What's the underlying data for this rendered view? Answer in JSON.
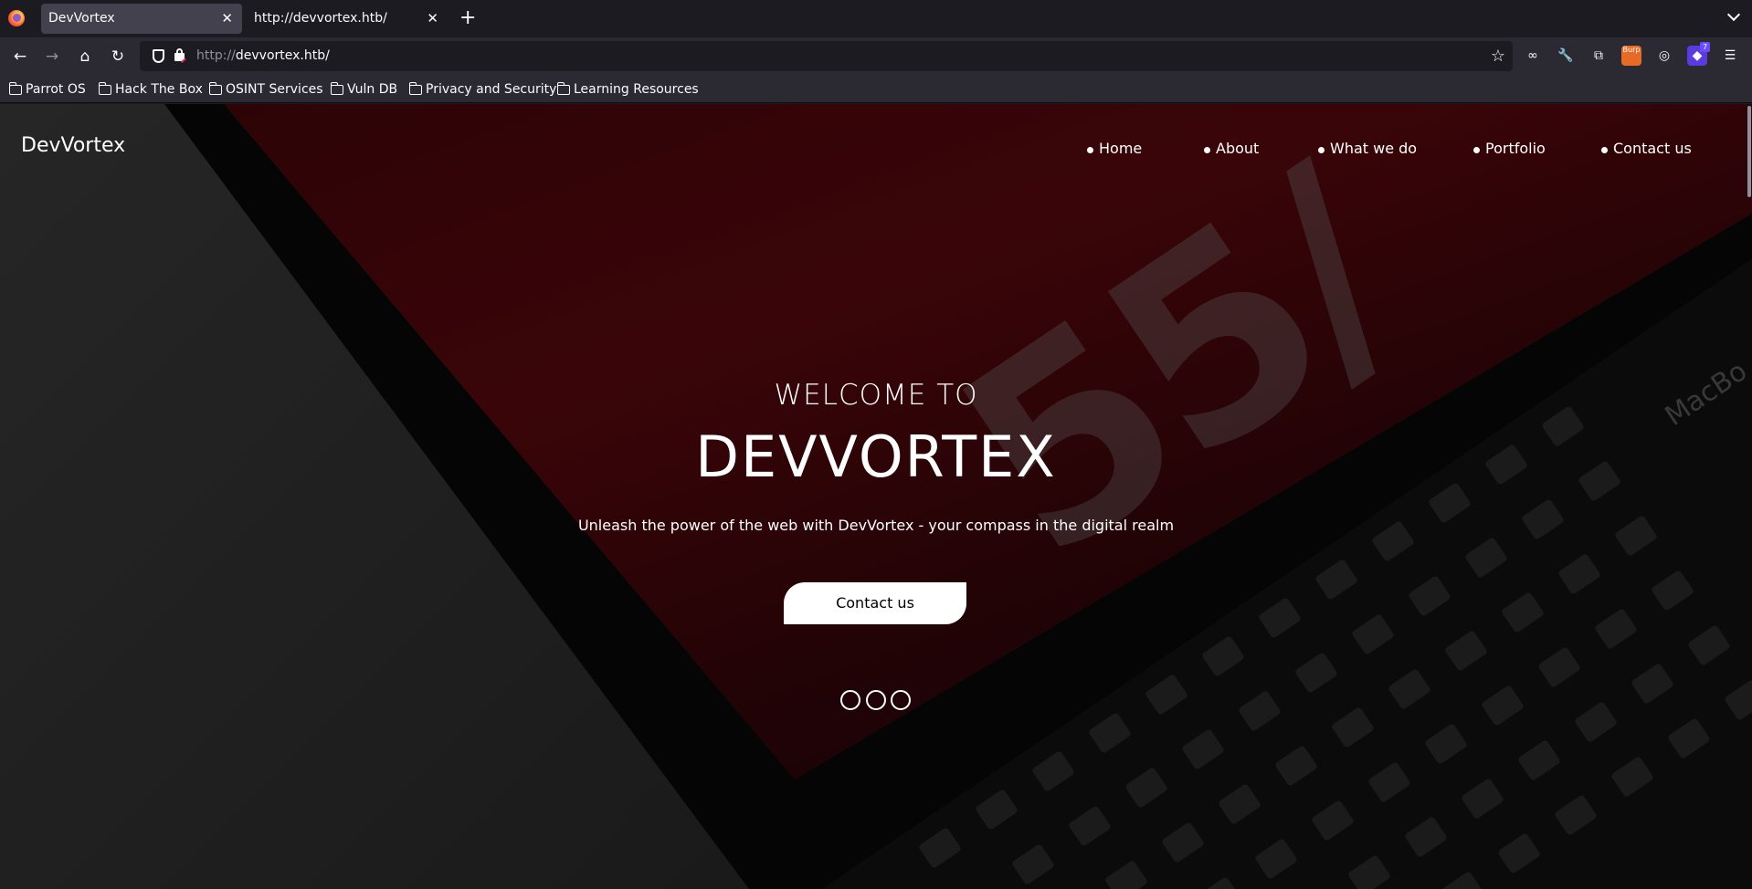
{
  "browser": {
    "tabs": [
      {
        "title": "DevVortex",
        "active": true
      },
      {
        "title": "http://devvortex.htb/",
        "active": false
      }
    ],
    "url_scheme": "http://",
    "url_host": "devvortex.htb/",
    "extension_badge": "7",
    "burp_label": "Burp",
    "bookmarks": [
      "Parrot OS",
      "Hack The Box",
      "OSINT Services",
      "Vuln DB",
      "Privacy and Security",
      "Learning Resources"
    ]
  },
  "site": {
    "logo": "DevVortex",
    "nav": [
      "Home",
      "About",
      "What we do",
      "Portfolio",
      "Contact us"
    ],
    "hero": {
      "welcome": "WELCOME TO",
      "title": "DEVVORTEX",
      "tagline": "Unleash the power of the web with DevVortex - your compass in the digital realm",
      "cta": "Contact us"
    },
    "background_stamp": "55/",
    "background_brand": "MacBo"
  },
  "colors": {
    "browser_bg": "#1c1b22",
    "toolbar_bg": "#2b2a33",
    "hero_accent": "#3a0508",
    "text": "#ffffff"
  }
}
